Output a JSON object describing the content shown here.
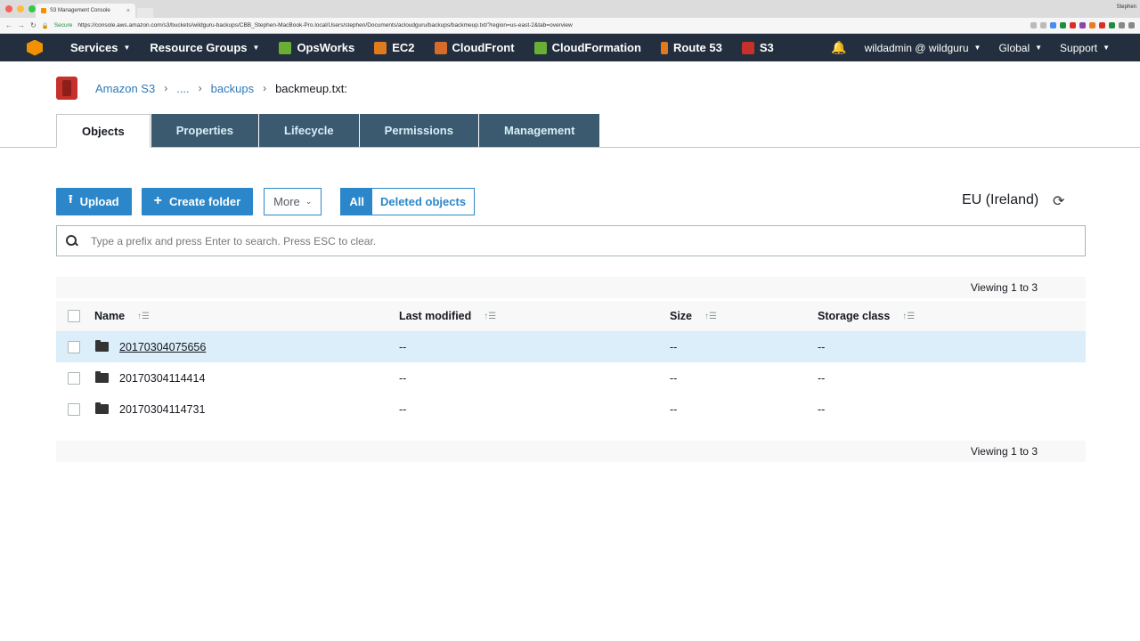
{
  "browser": {
    "tab_title": "S3 Management Console",
    "user": "Stephen",
    "secure_label": "Secure",
    "url": "https://console.aws.amazon.com/s3/buckets/wildguru-backups/CBB_Stephen-MacBook-Pro.local/Users/stephen/Documents/acloudguru/backups/backmeup.txt/?region=us-east-2&tab=overview"
  },
  "awsnav": {
    "services": "Services",
    "resource_groups": "Resource Groups",
    "shortcuts": [
      {
        "label": "OpsWorks",
        "color": "#6aaf35"
      },
      {
        "label": "EC2",
        "color": "#e07a1f"
      },
      {
        "label": "CloudFront",
        "color": "#d76b29"
      },
      {
        "label": "CloudFormation",
        "color": "#6aaf35"
      },
      {
        "label": "Route 53",
        "color": "#e07a1f"
      },
      {
        "label": "S3",
        "color": "#c7312b"
      }
    ],
    "account": "wildadmin @ wildguru",
    "region": "Global",
    "support": "Support"
  },
  "breadcrumb": {
    "root": "Amazon S3",
    "ellipsis": "....",
    "folder": "backups",
    "current": "backmeup.txt:"
  },
  "tabs": [
    "Objects",
    "Properties",
    "Lifecycle",
    "Permissions",
    "Management"
  ],
  "toolbar": {
    "upload": "Upload",
    "create_folder": "Create folder",
    "more": "More",
    "filter_all": "All",
    "filter_deleted": "Deleted objects",
    "region": "EU (Ireland)"
  },
  "search": {
    "placeholder": "Type a prefix and press Enter to search. Press ESC to clear."
  },
  "table": {
    "viewing_top": "Viewing 1 to 3",
    "viewing_bottom": "Viewing 1 to 3",
    "headers": {
      "name": "Name",
      "last_modified": "Last modified",
      "size": "Size",
      "storage_class": "Storage class"
    },
    "rows": [
      {
        "name": "20170304075656",
        "last_modified": "--",
        "size": "--",
        "storage_class": "--"
      },
      {
        "name": "20170304114414",
        "last_modified": "--",
        "size": "--",
        "storage_class": "--"
      },
      {
        "name": "20170304114731",
        "last_modified": "--",
        "size": "--",
        "storage_class": "--"
      }
    ]
  }
}
